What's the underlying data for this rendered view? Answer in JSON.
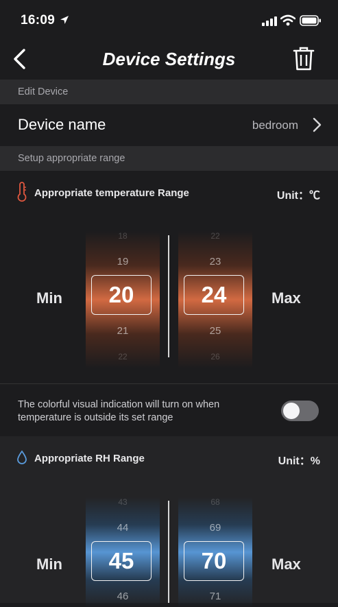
{
  "status": {
    "time": "16:09"
  },
  "nav": {
    "title": "Device Settings"
  },
  "edit_device": {
    "header": "Edit Device",
    "device_name_label": "Device name",
    "device_name_value": "bedroom"
  },
  "range_header": "Setup appropriate range",
  "temperature": {
    "title": "Appropriate temperature Range",
    "unit": "Unit：℃",
    "min_label": "Min",
    "max_label": "Max",
    "min_picker": {
      "above2": "18",
      "above1": "19",
      "selected": "20",
      "below1": "21",
      "below2": "22"
    },
    "max_picker": {
      "above2": "22",
      "above1": "23",
      "selected": "24",
      "below1": "25",
      "below2": "26"
    },
    "accent": "#e06c4a"
  },
  "indication": {
    "text": "The colorful visual indication will turn on when temperature is outside its set range",
    "enabled": false
  },
  "humidity": {
    "title": "Appropriate RH Range",
    "unit": "Unit：%",
    "min_label": "Min",
    "max_label": "Max",
    "min_picker": {
      "above2": "43",
      "above1": "44",
      "selected": "45",
      "below1": "46"
    },
    "max_picker": {
      "above2": "68",
      "above1": "69",
      "selected": "70",
      "below1": "71"
    },
    "accent": "#5a9bdc"
  },
  "icons": [
    "location-arrow-icon",
    "signal-icon",
    "wifi-icon",
    "battery-icon",
    "back-chevron-icon",
    "trash-icon",
    "chevron-right-icon",
    "thermometer-icon",
    "droplet-icon"
  ]
}
